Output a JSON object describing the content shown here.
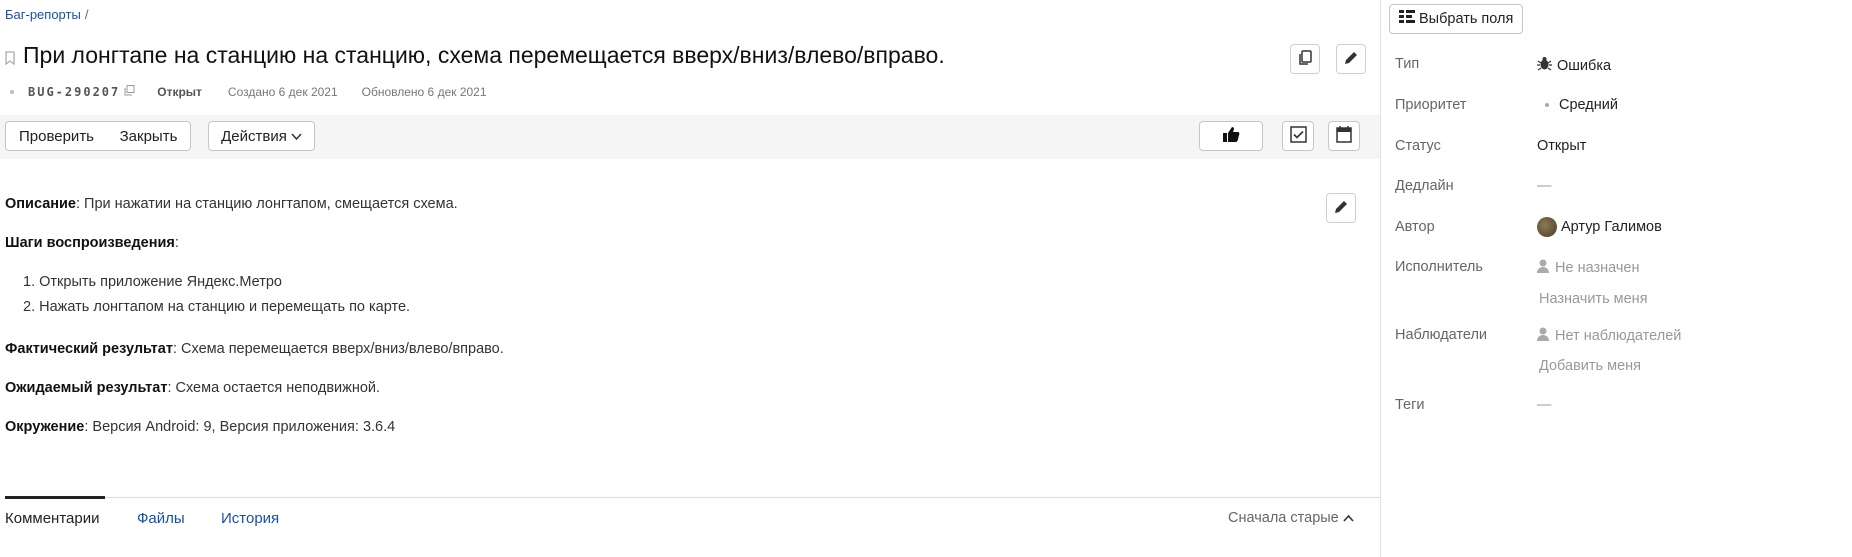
{
  "breadcrumb": {
    "item": "Баг-репорты",
    "separator": "/"
  },
  "issue": {
    "title": "При лонгтапе на станцию на станцию, схема перемещается вверх/вниз/влево/вправо.",
    "key": "BUG-290207",
    "status": "Открыт",
    "created": "Создано 6 дек 2021",
    "updated": "Обновлено 6 дек 2021"
  },
  "toolbar": {
    "check_label": "Проверить",
    "close_label": "Закрыть",
    "actions_label": "Действия"
  },
  "description": {
    "desc_label": "Описание",
    "desc_text": ": При нажатии на станцию лонгтапом, смещается схема.",
    "steps_label": "Шаги воспроизведения",
    "steps_colon": ":",
    "steps": [
      "1. Открыть приложение Яндекс.Метро",
      "2. Нажать лонгтапом на станцию и перемещать по карте."
    ],
    "actual_label": "Фактический результат",
    "actual_text": ": Схема перемещается вверх/вниз/влево/вправо.",
    "expected_label": "Ожидаемый результат",
    "expected_text": ": Схема остается неподвижной.",
    "env_label": "Окружение",
    "env_text": ": Версия Android: 9, Версия приложения: 3.6.4"
  },
  "tabs": {
    "comments": "Комментарии",
    "files": "Файлы",
    "history": "История",
    "sort": "Сначала старые"
  },
  "sidebar": {
    "pick_fields": "Выбрать поля",
    "type_label": "Тип",
    "type_value": "Ошибка",
    "priority_label": "Приоритет",
    "priority_value": "Средний",
    "status_label": "Статус",
    "status_value": "Открыт",
    "deadline_label": "Дедлайн",
    "deadline_value": "—",
    "author_label": "Автор",
    "author_value": "Артур Галимов",
    "assignee_label": "Исполнитель",
    "assignee_value": "Не назначен",
    "assign_me": "Назначить меня",
    "watchers_label": "Наблюдатели",
    "watchers_value": "Нет наблюдателей",
    "add_me": "Добавить меня",
    "tags_label": "Теги",
    "tags_value": "—"
  },
  "colors": {
    "link": "#1a4fa8",
    "toolbar_bg": "#f5f5f5",
    "muted": "#999999"
  }
}
